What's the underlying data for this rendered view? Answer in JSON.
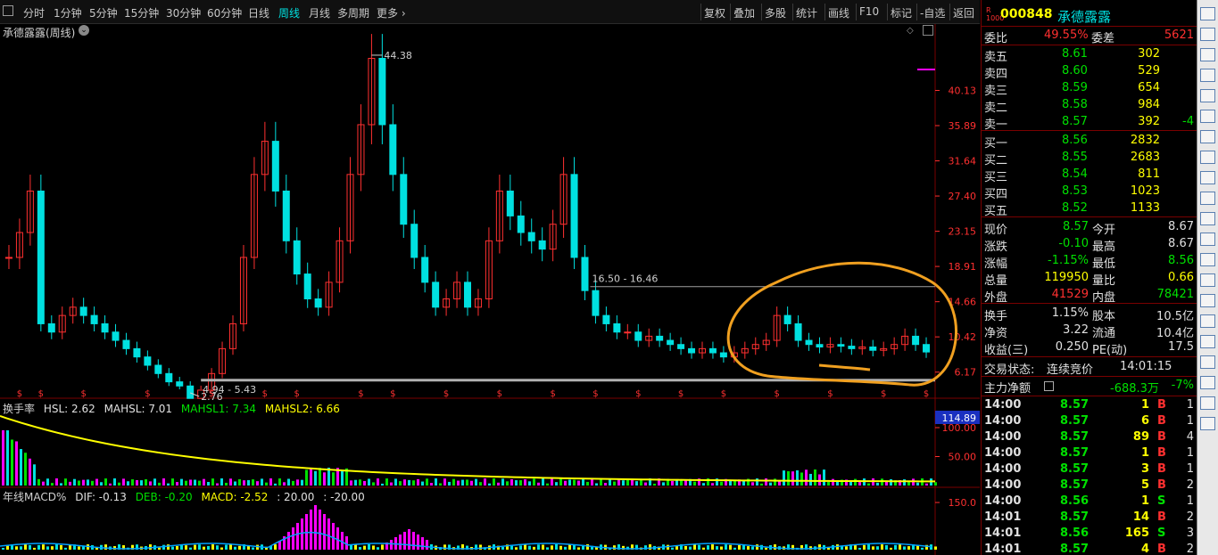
{
  "toolbar": {
    "items": [
      "分时",
      "1分钟",
      "5分钟",
      "15分钟",
      "30分钟",
      "60分钟",
      "日线",
      "周线",
      "月线",
      "多周期",
      "更多"
    ],
    "active": "周线",
    "right_items": [
      "复权",
      "叠加",
      "多股",
      "统计",
      "画线",
      "F10",
      "标记",
      "-自选",
      "返回"
    ]
  },
  "chart_title": "承德露露(周线)",
  "chart_data": [
    {
      "type": "candlestick",
      "title": "承德露露(周线)",
      "y_ticks": [
        40.13,
        35.89,
        31.64,
        27.4,
        23.15,
        18.91,
        14.66,
        10.42,
        6.17
      ],
      "ylim": [
        4.1,
        46.2
      ],
      "annotations": {
        "high": "44.38",
        "low": "2.76",
        "resistance": "16.50 - 16.46",
        "support": "4.94 - 5.43"
      },
      "dividend_marker": "$",
      "approx_close": [
        20,
        23,
        28,
        12,
        11,
        13,
        14,
        13,
        12,
        11,
        10,
        9,
        8,
        7,
        6,
        5,
        4.5,
        3,
        4,
        6,
        9,
        12,
        20,
        30,
        34,
        28,
        22,
        18,
        15,
        14,
        17,
        22,
        30,
        36,
        44,
        36,
        30,
        24,
        20,
        17,
        14,
        15,
        17,
        14,
        15,
        22,
        28,
        25,
        23,
        22,
        21,
        24,
        30,
        20,
        16,
        13,
        12,
        11,
        11,
        10,
        10.5,
        10,
        9.5,
        9,
        8.5,
        9,
        8.5,
        8,
        8.5,
        9,
        9.5,
        10,
        13,
        12,
        10,
        9.5,
        9.2,
        9.5,
        9.3,
        9,
        9.2,
        8.8,
        9,
        9.5,
        10.5,
        9.5,
        8.6
      ]
    },
    {
      "type": "bar",
      "title": "换手率",
      "series_labels": [
        "HSL: 2.62",
        "MAHSL: 7.01",
        "MAHSL1: 7.34",
        "MAHSL2: 6.66"
      ],
      "y_ticks": [
        100.0,
        50.0
      ],
      "max_label": "114.89"
    },
    {
      "type": "bar",
      "title": "年线MACD%",
      "series_labels": [
        "DIF: -0.13",
        "DEB: -0.20",
        "MACD: -2.52",
        ": 20.00",
        ": -20.00"
      ],
      "y_ticks": [
        150.0
      ]
    }
  ],
  "quote": {
    "code": "000848",
    "name": "承德露露",
    "weibi_label": "委比",
    "weibi": "49.55%",
    "weicha_label": "委差",
    "weicha": "5621",
    "asks": [
      {
        "label": "卖五",
        "price": "8.61",
        "vol": "302",
        "chg": ""
      },
      {
        "label": "卖四",
        "price": "8.60",
        "vol": "529",
        "chg": ""
      },
      {
        "label": "卖三",
        "price": "8.59",
        "vol": "654",
        "chg": ""
      },
      {
        "label": "卖二",
        "price": "8.58",
        "vol": "984",
        "chg": ""
      },
      {
        "label": "卖一",
        "price": "8.57",
        "vol": "392",
        "chg": "-4"
      }
    ],
    "bids": [
      {
        "label": "买一",
        "price": "8.56",
        "vol": "2832"
      },
      {
        "label": "买二",
        "price": "8.55",
        "vol": "2683"
      },
      {
        "label": "买三",
        "price": "8.54",
        "vol": "811"
      },
      {
        "label": "买四",
        "price": "8.53",
        "vol": "1023"
      },
      {
        "label": "买五",
        "price": "8.52",
        "vol": "1133"
      }
    ],
    "stats": [
      {
        "l1": "现价",
        "v1": "8.57",
        "l2": "今开",
        "v2": "8.67"
      },
      {
        "l1": "涨跌",
        "v1": "-0.10",
        "l2": "最高",
        "v2": "8.67"
      },
      {
        "l1": "涨幅",
        "v1": "-1.15%",
        "l2": "最低",
        "v2": "8.56"
      },
      {
        "l1": "总量",
        "v1": "119950",
        "l2": "量比",
        "v2": "0.66"
      },
      {
        "l1": "外盘",
        "v1": "41529",
        "l2": "内盘",
        "v2": "78421"
      }
    ],
    "fin": [
      {
        "l1": "换手",
        "v1": "1.15%",
        "l2": "股本",
        "v2": "10.5亿"
      },
      {
        "l1": "净资",
        "v1": "3.22",
        "l2": "流通",
        "v2": "10.4亿"
      },
      {
        "l1": "收益(三)",
        "v1": "0.250",
        "l2": "PE(动)",
        "v2": "17.5"
      }
    ],
    "trade_status_label": "交易状态:",
    "trade_status": "连续竞价",
    "trade_time": "14:01:15",
    "main_net_label": "主力净额",
    "main_net": "-688.3万",
    "main_net_pct": "-7%",
    "ticks": [
      {
        "t": "14:00",
        "p": "8.57",
        "v": "1",
        "s": "B",
        "n": "1"
      },
      {
        "t": "14:00",
        "p": "8.57",
        "v": "6",
        "s": "B",
        "n": "1"
      },
      {
        "t": "14:00",
        "p": "8.57",
        "v": "89",
        "s": "B",
        "n": "4"
      },
      {
        "t": "14:00",
        "p": "8.57",
        "v": "1",
        "s": "B",
        "n": "1"
      },
      {
        "t": "14:00",
        "p": "8.57",
        "v": "3",
        "s": "B",
        "n": "1"
      },
      {
        "t": "14:00",
        "p": "8.57",
        "v": "5",
        "s": "B",
        "n": "2"
      },
      {
        "t": "14:00",
        "p": "8.56",
        "v": "1",
        "s": "S",
        "n": "1"
      },
      {
        "t": "14:01",
        "p": "8.57",
        "v": "14",
        "s": "B",
        "n": "2"
      },
      {
        "t": "14:01",
        "p": "8.56",
        "v": "165",
        "s": "S",
        "n": "3"
      },
      {
        "t": "14:01",
        "p": "8.57",
        "v": "4",
        "s": "B",
        "n": "2"
      }
    ]
  },
  "colors": {
    "up": "#ff3030",
    "down": "#00e0e0",
    "yellow": "#ffff00",
    "magenta": "#ff00ff",
    "green": "#00e000",
    "circle": "#f0a020"
  }
}
